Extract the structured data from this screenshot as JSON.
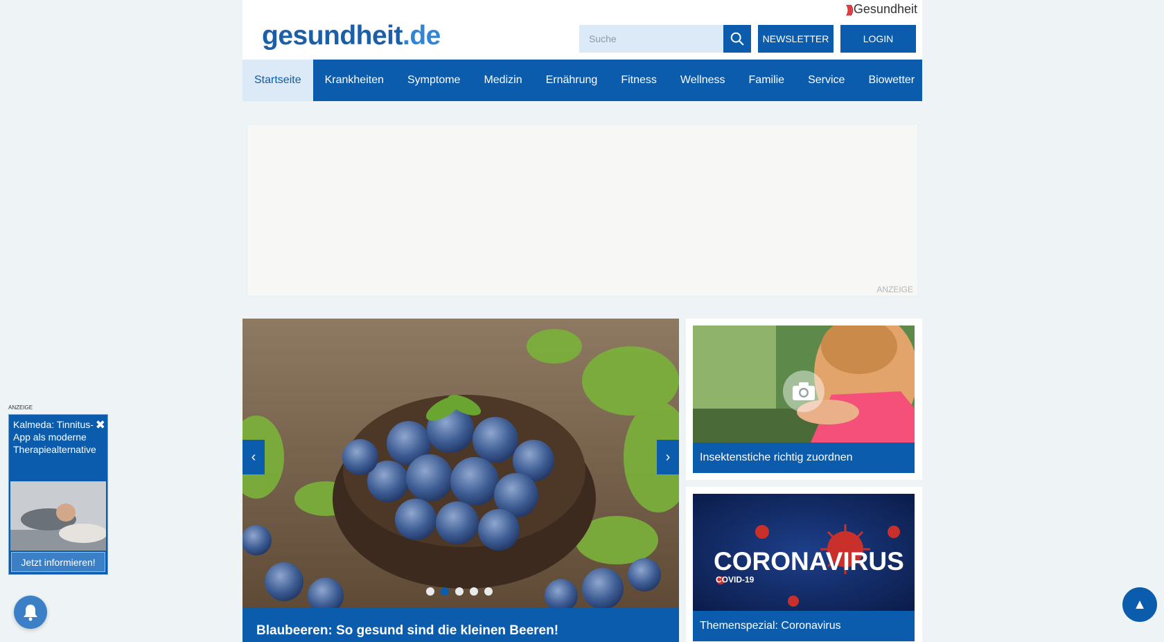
{
  "header": {
    "brand_top": "Gesundheit",
    "logo_main": "gesundheit",
    "logo_tld": ".de",
    "search_placeholder": "Suche",
    "newsletter_label": "NEWSLETTER",
    "login_label": "LOGIN"
  },
  "nav": {
    "items": [
      "Startseite",
      "Krankheiten",
      "Symptome",
      "Medizin",
      "Ernährung",
      "Fitness",
      "Wellness",
      "Familie",
      "Service",
      "Biowetter"
    ],
    "active": "Startseite"
  },
  "ad": {
    "label": "ANZEIGE"
  },
  "hero": {
    "caption": "Blaubeeren: So gesund sind die kleinen Beeren!",
    "prev_icon": "‹",
    "next_icon": "›",
    "dot_count": 5,
    "active_dot": 2
  },
  "cards": [
    {
      "caption": "Insektenstiche richtig zuordnen"
    },
    {
      "caption": "Themenspezial: Coronavirus",
      "image_title": "CORONAVIRUS",
      "image_subtitle": "COVID-19"
    }
  ],
  "popup_ad": {
    "label": "ANZEIGE",
    "text": "Kalmeda: Tinnitus-App als moderne Therapiealternative",
    "button": "Jetzt informieren!",
    "close": "✖"
  },
  "back_to_top": "▲",
  "colors": {
    "primary": "#0b5cad",
    "accent_red": "#d6262e",
    "background": "#eef3f5"
  }
}
